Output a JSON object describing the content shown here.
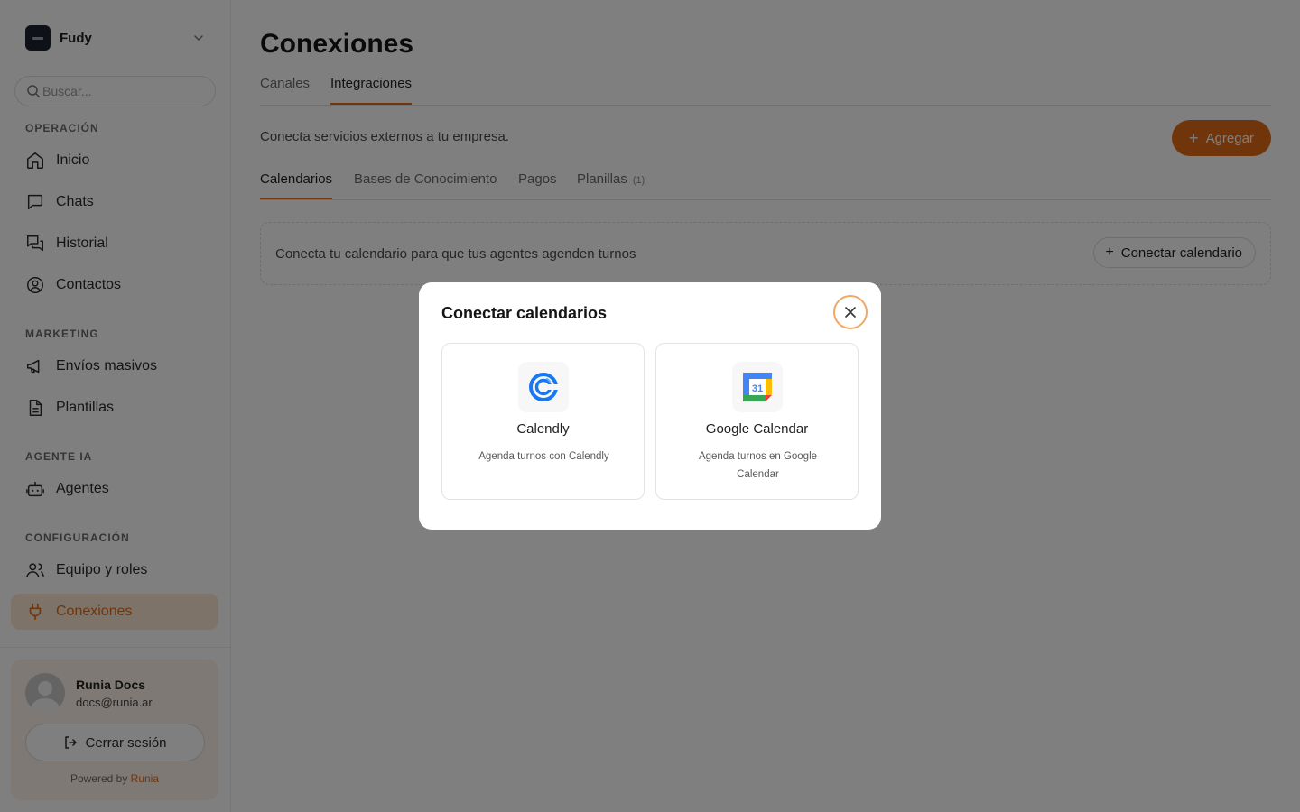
{
  "workspace": {
    "name": "Fudy"
  },
  "search": {
    "placeholder": "Buscar..."
  },
  "sidebar": {
    "sections": {
      "operacion": "OPERACIÓN",
      "marketing": "MARKETING",
      "agente": "AGENTE IA",
      "config": "CONFIGURACIÓN"
    },
    "items": {
      "inicio": "Inicio",
      "chats": "Chats",
      "historial": "Historial",
      "contactos": "Contactos",
      "envios": "Envíos masivos",
      "plantillas": "Plantillas",
      "agentes": "Agentes",
      "equipo": "Equipo y roles",
      "conexiones": "Conexiones"
    },
    "active": "conexiones"
  },
  "user": {
    "name": "Runia Docs",
    "email": "docs@runia.ar",
    "logout_label": "Cerrar sesión",
    "powered_prefix": "Powered by",
    "powered_brand": "Runia"
  },
  "page": {
    "title": "Conexiones",
    "tabs": [
      "Canales",
      "Integraciones"
    ],
    "active_tab": "Integraciones",
    "description": "Conecta servicios externos a tu empresa.",
    "add_label": "Agregar",
    "subtabs": [
      "Calendarios",
      "Bases de Conocimiento",
      "Pagos",
      "Planillas"
    ],
    "planillas_count": "(1)",
    "active_subtab": "Calendarios",
    "calendar_prompt": "Conecta tu calendario para que tus agentes agenden turnos",
    "connect_calendar_label": "Conectar calendario"
  },
  "modal": {
    "title": "Conectar calendarios",
    "options": [
      {
        "name": "Calendly",
        "description": "Agenda turnos con Calendly",
        "icon": "calendly-icon"
      },
      {
        "name": "Google Calendar",
        "description": "Agenda turnos en Google Calendar",
        "icon": "google-calendar-icon",
        "day": "31"
      }
    ]
  },
  "colors": {
    "accent": "#e36a16",
    "active_bg": "#fbe7d2",
    "overlay": "rgba(0,0,0,0.5)",
    "close_ring": "#f0a866"
  }
}
